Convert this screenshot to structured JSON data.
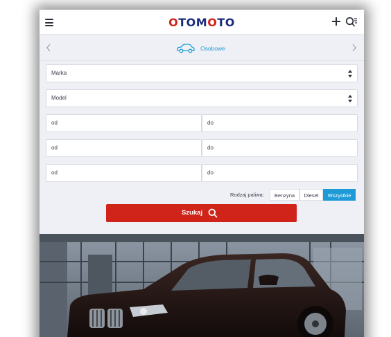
{
  "header": {
    "logo_text": "OTOMOTO",
    "icons": [
      "hamburger-icon",
      "plus-icon",
      "search-filter-icon"
    ]
  },
  "category": {
    "label": "Osobowe",
    "icon": "car-icon"
  },
  "form": {
    "make_value": "Marka",
    "model_value": "Model",
    "ranges": [
      {
        "from": "od",
        "to": "do"
      },
      {
        "from": "od",
        "to": "do"
      },
      {
        "from": "od",
        "to": "do"
      }
    ],
    "fuel_label": "Rodzaj paliwa:",
    "fuel_options": [
      "Benzyna",
      "Diesel",
      "Wszystkie"
    ],
    "fuel_selected": "Wszystkie",
    "submit_label": "Szukaj"
  },
  "colors": {
    "brand_red": "#d0241a",
    "brand_navy": "#1c2a7a",
    "accent_blue": "#1e9bd7",
    "background": "#eef0f5"
  }
}
